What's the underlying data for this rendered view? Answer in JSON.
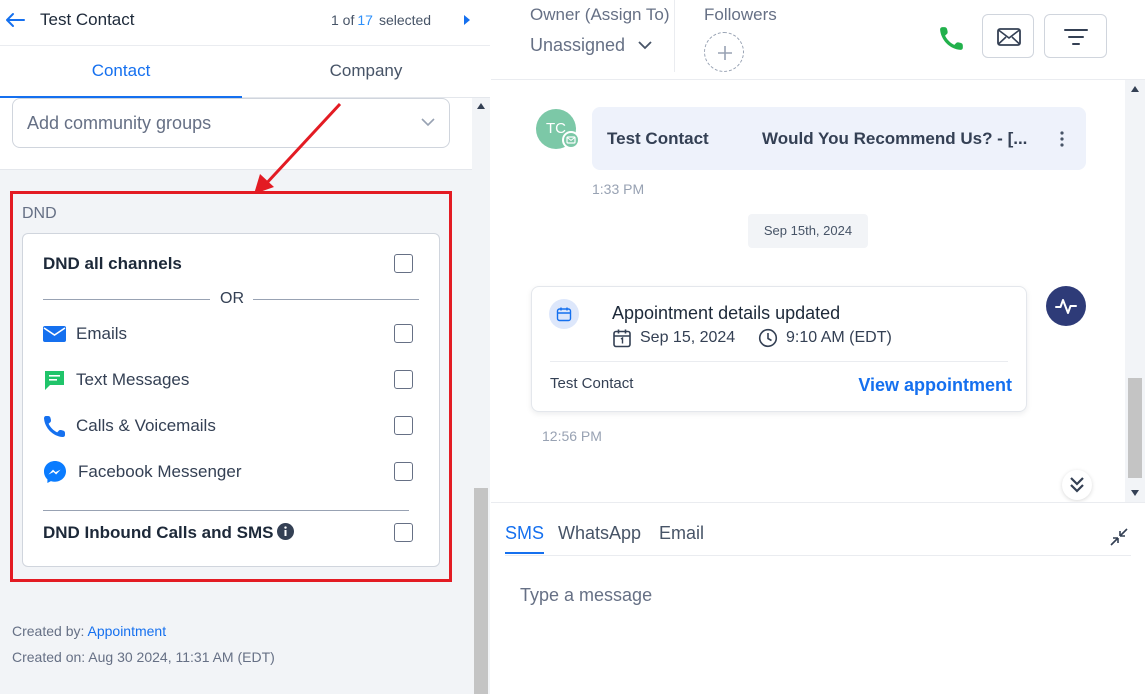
{
  "header": {
    "contact_name": "Test Contact",
    "pager_prefix": "1 of",
    "pager_count": "17",
    "pager_suffix": "selected"
  },
  "tabs": [
    {
      "label": "Contact",
      "active": true
    },
    {
      "label": "Company",
      "active": false
    }
  ],
  "community_groups": {
    "placeholder": "Add community groups"
  },
  "dnd": {
    "section_label": "DND",
    "all_channels": {
      "label": "DND all channels",
      "checked": false
    },
    "or_label": "OR",
    "channels": [
      {
        "label": "Emails",
        "icon": "email-icon",
        "checked": false
      },
      {
        "label": "Text Messages",
        "icon": "sms-icon",
        "checked": false
      },
      {
        "label": "Calls & Voicemails",
        "icon": "phone-icon",
        "checked": false
      },
      {
        "label": "Facebook Messenger",
        "icon": "messenger-icon",
        "checked": false
      }
    ],
    "inbound": {
      "label": "DND Inbound Calls and SMS",
      "checked": false
    }
  },
  "created": {
    "by_label": "Created by:",
    "by_value": "Appointment",
    "on_label": "Created on:",
    "on_value": "Aug 30 2024, 11:31 AM (EDT)"
  },
  "conversation_header": {
    "owner_label": "Owner (Assign To)",
    "owner_value": "Unassigned",
    "followers_label": "Followers"
  },
  "messages": {
    "avatar_initials": "TC",
    "first": {
      "from": "Test Contact",
      "subject": "Would You Recommend Us?  -  [...",
      "time": "1:33 PM"
    },
    "date_divider": "Sep 15th, 2024",
    "appointment": {
      "title": "Appointment details updated",
      "date": "Sep 15, 2024",
      "time": "9:10 AM (EDT)",
      "contact": "Test Contact",
      "link": "View appointment",
      "timestamp": "12:56 PM"
    }
  },
  "composer": {
    "tabs": [
      {
        "label": "SMS",
        "active": true
      },
      {
        "label": "WhatsApp",
        "active": false
      },
      {
        "label": "Email",
        "active": false
      }
    ],
    "placeholder": "Type a message"
  },
  "colors": {
    "accent": "#1570ef",
    "annotation_red": "#e31b23",
    "phone_green": "#22b14c",
    "sms_green": "#20c46a",
    "messenger_blue": "#0a7cff",
    "avatar_green": "#7cc8a7",
    "activity_navy": "#2e3b78"
  }
}
